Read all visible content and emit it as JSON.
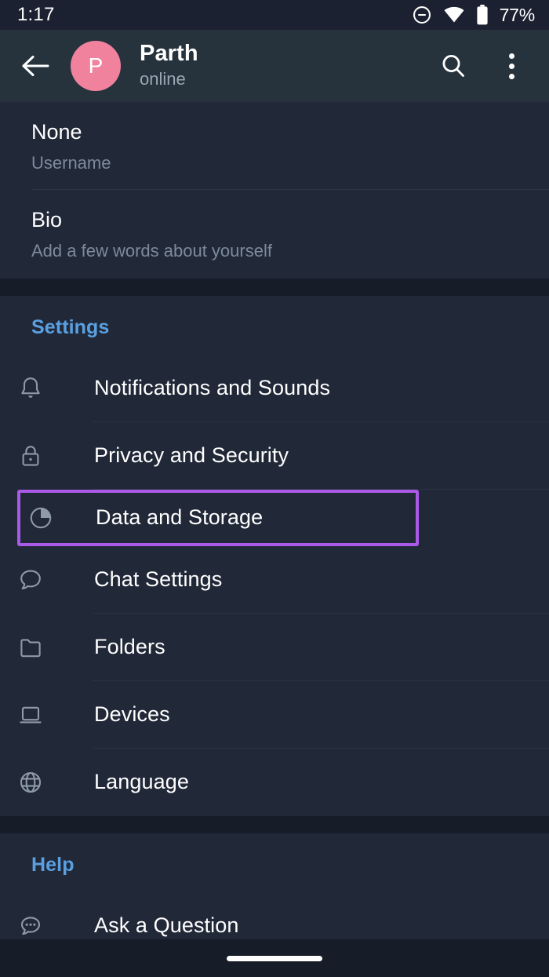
{
  "status_bar": {
    "time": "1:17",
    "battery_percent": "77%",
    "icons": [
      "do-not-disturb-icon",
      "wifi-icon",
      "battery-icon"
    ]
  },
  "app_bar": {
    "back_icon": "back-arrow-icon",
    "avatar_initial": "P",
    "avatar_color": "#f0829e",
    "title": "Parth",
    "subtitle": "online",
    "search_icon": "search-icon",
    "menu_icon": "overflow-menu-icon"
  },
  "profile": {
    "rows": [
      {
        "value": "None",
        "label": "Username"
      },
      {
        "value": "Bio",
        "label": "Add a few words about yourself"
      }
    ]
  },
  "settings_section": {
    "header": "Settings",
    "accent_color": "#5aa0e0",
    "items": [
      {
        "label": "Notifications and Sounds",
        "icon": "bell-icon",
        "highlighted": false
      },
      {
        "label": "Privacy and Security",
        "icon": "lock-icon",
        "highlighted": false
      },
      {
        "label": "Data and Storage",
        "icon": "pie-chart-icon",
        "highlighted": true
      },
      {
        "label": "Chat Settings",
        "icon": "chat-bubble-icon",
        "highlighted": false
      },
      {
        "label": "Folders",
        "icon": "folder-icon",
        "highlighted": false
      },
      {
        "label": "Devices",
        "icon": "laptop-icon",
        "highlighted": false
      },
      {
        "label": "Language",
        "icon": "globe-icon",
        "highlighted": false
      }
    ]
  },
  "help_section": {
    "header": "Help",
    "items": [
      {
        "label": "Ask a Question",
        "icon": "chat-dots-icon",
        "highlighted": false
      }
    ]
  },
  "highlight": {
    "color": "#ab5ae8"
  },
  "nav_bar": {
    "pill": "home-gesture-pill"
  }
}
